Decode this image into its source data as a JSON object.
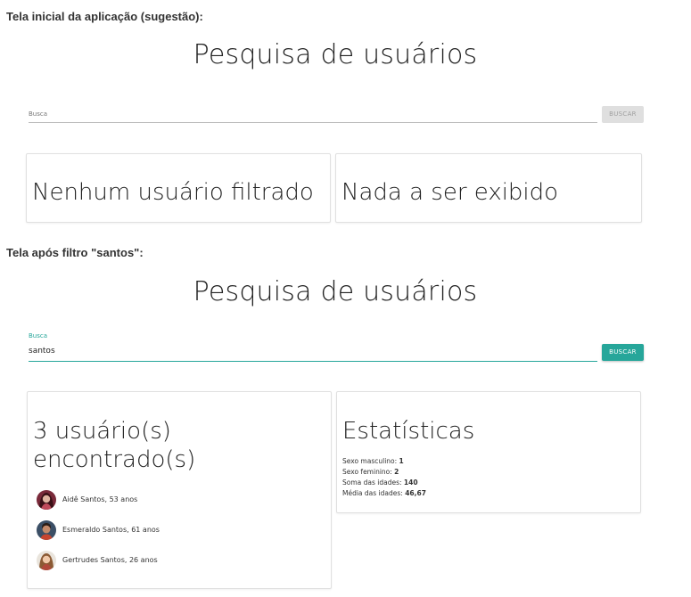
{
  "screen1": {
    "caption": "Tela inicial da aplicação (sugestão):",
    "title": "Pesquisa de usuários",
    "search": {
      "label": "",
      "placeholder": "Busca",
      "value": ""
    },
    "button_label": "BUSCAR",
    "left_card_text": "Nenhum usuário filtrado",
    "right_card_text": "Nada a ser exibido"
  },
  "screen2": {
    "caption": "Tela após filtro \"santos\":",
    "title": "Pesquisa de usuários",
    "search": {
      "label": "Busca",
      "value": "santos"
    },
    "button_label": "BUSCAR",
    "results_heading_line1": "3 usuário(s)",
    "results_heading_line2": "encontrado(s)",
    "users": [
      {
        "text": "Aidê Santos, 53 anos",
        "icon": "avatar-female"
      },
      {
        "text": "Esmeraldo Santos, 61 anos",
        "icon": "avatar-male"
      },
      {
        "text": "Gertrudes Santos, 26 anos",
        "icon": "avatar-female"
      }
    ],
    "stats": {
      "heading": "Estatísticas",
      "male_label": "Sexo masculino: ",
      "male_value": "1",
      "female_label": "Sexo feminino: ",
      "female_value": "2",
      "sum_label": "Soma das idades: ",
      "sum_value": "140",
      "avg_label": "Média das idades: ",
      "avg_value": "46,67"
    }
  },
  "colors": {
    "accent": "#26a69a",
    "disabled_button": "#dfdfdf",
    "card_border": "#e0e0e0"
  }
}
